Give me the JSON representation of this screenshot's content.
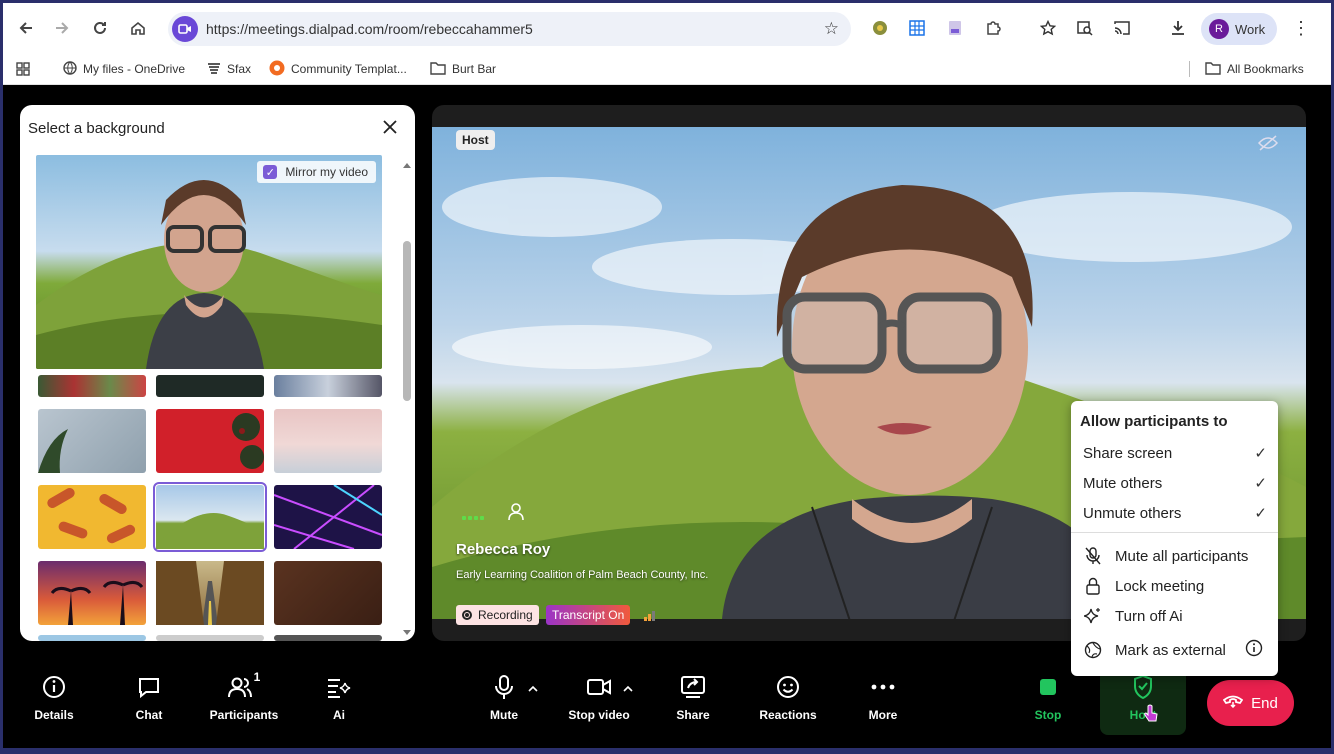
{
  "browser": {
    "url": "https://meetings.dialpad.com/room/rebeccahammer5",
    "profile_initial": "R",
    "profile_label": "Work",
    "bookmarks": [
      "My files - OneDrive",
      "Sfax",
      "Community Templat...",
      "Burt Bar"
    ],
    "all_bookmarks": "All Bookmarks"
  },
  "background_panel": {
    "title": "Select a background",
    "mirror_label": "Mirror my video"
  },
  "video": {
    "host_badge": "Host",
    "name": "Rebecca Roy",
    "org": "Early Learning Coalition of Palm Beach County, Inc.",
    "recording": "Recording",
    "transcript": "Transcript On"
  },
  "menu": {
    "title": "Allow participants to",
    "toggles": [
      "Share screen",
      "Mute others",
      "Unmute others"
    ],
    "actions": [
      "Mute all participants",
      "Lock meeting",
      "Turn off Ai",
      "Mark as external"
    ]
  },
  "toolbar": {
    "details": "Details",
    "chat": "Chat",
    "participants": "Participants",
    "participants_count": "1",
    "ai": "Ai",
    "mute": "Mute",
    "stop_video": "Stop video",
    "share": "Share",
    "reactions": "Reactions",
    "more": "More",
    "stop": "Stop",
    "host": "Host",
    "end": "End"
  },
  "colors": {
    "accent": "#7b5cd6",
    "end_button": "#e8204d",
    "stop_green": "#22c55e"
  }
}
